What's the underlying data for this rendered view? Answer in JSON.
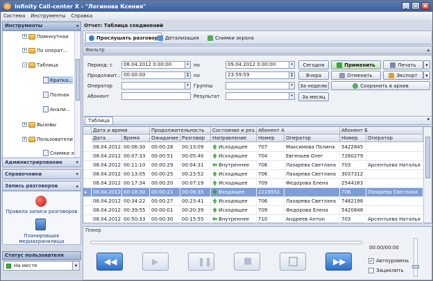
{
  "window": {
    "title": "Infinity Call-center X - \"Логинова Ксения\""
  },
  "menu": [
    "Система",
    "Инструменты",
    "Справка"
  ],
  "left": {
    "tools_title": "Инструменты",
    "tree": [
      "Помннутная",
      "По операт...",
      "Таблица",
      "Кратка...",
      "Полная",
      "Анали...",
      "Вызовы",
      "Пользователи",
      "Снимки эк..."
    ],
    "sections": [
      "Администрирование",
      "Справочники",
      "Запись разговоров"
    ],
    "rec_rules": "Правила записи разговоров",
    "rec_scheduler": "Планировщик медиахранилища",
    "status_title": "Статус пользователя",
    "status_value": "На месте"
  },
  "report": {
    "title": "Отчет: Таблица соединений",
    "tabs": [
      "Прослушать разговор",
      "Детализация",
      "Снимки экрана"
    ]
  },
  "filter": {
    "group": "Фильтр",
    "period_label": "Период: с",
    "period_from": "08.04.2012 0:00:00",
    "to1": "по",
    "period_to": "09.04.2012 0:00:00",
    "dur_label": "Продолжит.: с",
    "dur_from": "00:00:00",
    "to2": "по",
    "dur_to": "23:59:59",
    "operator_label": "Оператор",
    "groups_label": "Группы",
    "subscriber_label": "Абонент",
    "result_label": "Результат",
    "today": "Сегодня",
    "yesterday": "Вчера",
    "week": "За неделю",
    "month": "За месяц",
    "apply": "Применить",
    "print": "Печать",
    "cancel": "Отменить",
    "export": "Экспорт",
    "archive": "Сохранить в архив"
  },
  "table": {
    "tab": "Таблица",
    "group_headers": [
      "Дата и время",
      "Продолжительность",
      "Состояние и рез...",
      "Абонент А",
      "Абонент Б"
    ],
    "headers": [
      "Дата",
      "Время",
      "Ожидание",
      "Разговор",
      "Направление",
      "Номер",
      "Оператор",
      "Номер",
      "Оператор"
    ],
    "rows": [
      [
        "08.04.2012",
        "00:06:30",
        "00:00:28",
        "00:13:09",
        "Исходящее",
        "707",
        "Максимова Полина",
        "5422845",
        ""
      ],
      [
        "08.04.2012",
        "00:07:33",
        "00:00:51",
        "00:05:40",
        "Исходящее",
        "704",
        "Евгеньев Олег",
        "7260279",
        ""
      ],
      [
        "08.04.2012",
        "00:11:10",
        "00:00:29",
        "00:04:31",
        "Внутреннее",
        "706",
        "Лазарева Светлана",
        "703",
        "Арсентьева Наталья"
      ],
      [
        "08.04.2012",
        "00:13:05",
        "00:00:25",
        "00:23:52",
        "Исходящее",
        "706",
        "Лазарева Светлана",
        "3037312",
        ""
      ],
      [
        "08.04.2012",
        "00:17:34",
        "00:00:20",
        "00:07:19",
        "Исходящее",
        "709",
        "Федорова Елена",
        "2544163",
        ""
      ],
      [
        "08.04.2012",
        "00:18:30",
        "00:00:21",
        "00:06:35",
        "Входящее",
        "2219932",
        "",
        "706",
        "Лазарева Светлана"
      ],
      [
        "08.04.2012",
        "00:34:22",
        "00:00:27",
        "00:23:41",
        "Исходящее",
        "706",
        "Лазарева Светлана",
        "7482198",
        ""
      ],
      [
        "08.04.2012",
        "00:39:55",
        "00:00:01",
        "00:20:39",
        "Исходящее",
        "709",
        "Федорова Елена",
        "5420848",
        ""
      ],
      [
        "08.04.2012",
        "00:50:33",
        "00:00:30",
        "00:15:55",
        "Внутреннее",
        "710",
        "Андреев Антон",
        "703",
        "Арсентьева Наталья"
      ]
    ]
  },
  "player": {
    "group": "Плеер",
    "time": "00:00/00:00",
    "auto_level": "Автоуровень",
    "loop": "Зациклить"
  }
}
